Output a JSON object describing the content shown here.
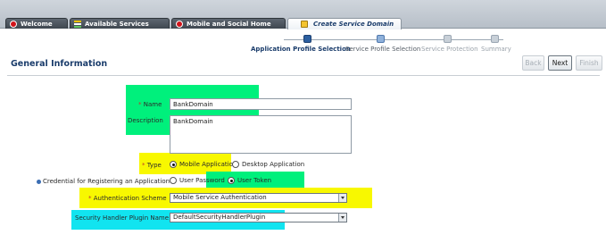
{
  "tabs": [
    {
      "label": "Welcome",
      "icon": "oracle-o-icon"
    },
    {
      "label": "Available Services",
      "icon": "services-bars-icon"
    },
    {
      "label": "Mobile and Social Home",
      "icon": "oracle-o-icon"
    },
    {
      "label": "Create Service Domain",
      "icon": "document-icon",
      "active": true
    }
  ],
  "train": {
    "steps": [
      {
        "label": "Application Profile Selection",
        "state": "current"
      },
      {
        "label": "Service Profile Selection",
        "state": "next"
      },
      {
        "label": "Service Protection",
        "state": "disabled"
      },
      {
        "label": "Summary",
        "state": "disabled"
      }
    ]
  },
  "section_title": "General Information",
  "buttons": {
    "back": "Back",
    "next": "Next",
    "finish": "Finish"
  },
  "form": {
    "name_label": "Name",
    "name_value": "BankDomain",
    "description_label": "Description",
    "description_value": "BankDomain",
    "type_label": "Type",
    "type_options": [
      "Mobile Application",
      "Desktop Application"
    ],
    "type_selected": "Mobile Application",
    "credential_label": "Credential for Registering an Application",
    "credential_options": [
      "User Password",
      "User Token"
    ],
    "credential_selected": "User Token",
    "auth_scheme_label": "Authentication Scheme",
    "auth_scheme_value": "Mobile Service Authentication",
    "plugin_label": "Security Handler Plugin Name",
    "plugin_value": "DefaultSecurityHandlerPlugin",
    "required_marker": "*"
  },
  "colors": {
    "highlight_green": "#00f07c",
    "highlight_yellow": "#f8f800",
    "highlight_cyan": "#11e4f0",
    "accent": "#1a3c6b"
  }
}
